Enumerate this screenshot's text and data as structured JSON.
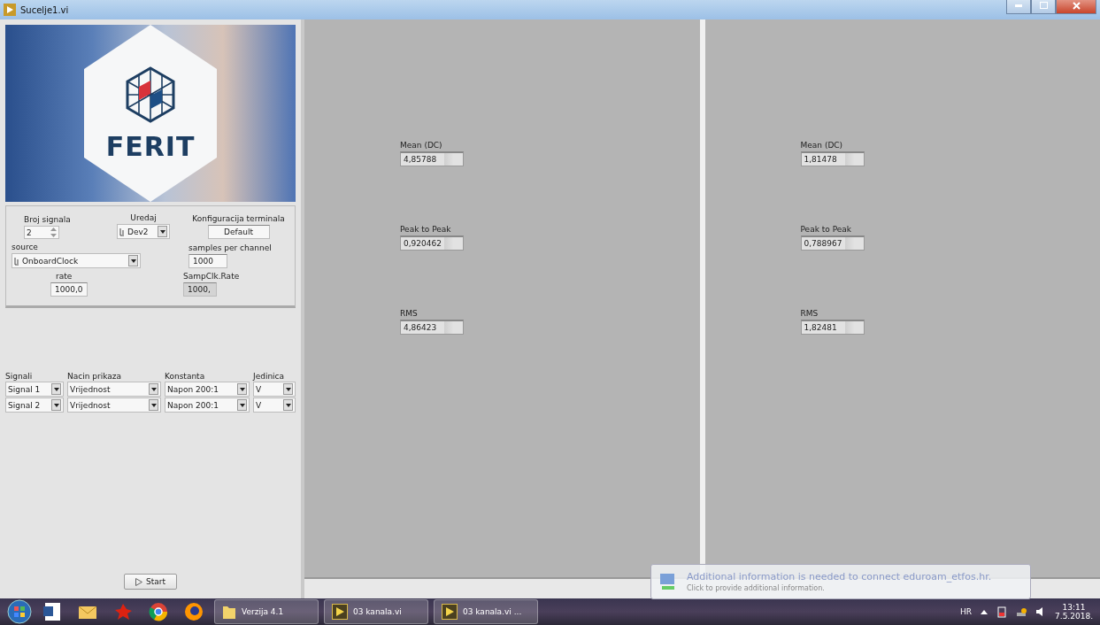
{
  "window": {
    "title": "Sucelje1.vi"
  },
  "logo": {
    "text": "FERIT"
  },
  "config": {
    "channel_count": {
      "label": "Broj signala",
      "value": "2"
    },
    "device": {
      "label": "Uredaj",
      "value": "Dev2"
    },
    "terminal_config": {
      "label": "Konfiguracija terminala",
      "value": "Default"
    },
    "source": {
      "label": "source",
      "value": "OnboardClock"
    },
    "samples_per_channel": {
      "label": "samples per channel",
      "value": "1000"
    },
    "rate": {
      "label": "rate",
      "value": "1000,0"
    },
    "samp_clk_rate": {
      "label": "SampClk.Rate",
      "value": "1000,"
    }
  },
  "signals_table": {
    "columns": [
      "Signali",
      "Nacin prikaza",
      "Konstanta",
      "Jedinica"
    ],
    "rows": [
      [
        "Signal 1",
        "Vrijednost",
        "Napon 200:1",
        "V"
      ],
      [
        "Signal 2",
        "Vrijednost",
        "Napon 200:1",
        "V"
      ]
    ]
  },
  "start_button": {
    "label": "Start"
  },
  "channels": [
    {
      "stats": [
        {
          "label": "Mean (DC)",
          "value": "4,85788"
        },
        {
          "label": "Peak to Peak",
          "value": "0,920462"
        },
        {
          "label": "RMS",
          "value": "4,86423"
        }
      ]
    },
    {
      "stats": [
        {
          "label": "Mean (DC)",
          "value": "1,81478"
        },
        {
          "label": "Peak to Peak",
          "value": "0,788967"
        },
        {
          "label": "RMS",
          "value": "1,82481"
        }
      ]
    }
  ],
  "notification": {
    "title": "Additional information is needed to connect eduroam_etfos.hr.",
    "text": "Click to provide additional information."
  },
  "taskbar": {
    "tasks": [
      {
        "kind": "folder",
        "label": "Verzija 4.1"
      },
      {
        "kind": "labview",
        "label": "03 kanala.vi"
      },
      {
        "kind": "labview",
        "label": "03 kanala.vi ..."
      }
    ],
    "language": "HR",
    "time": "13:11",
    "date": "7.5.2018."
  }
}
